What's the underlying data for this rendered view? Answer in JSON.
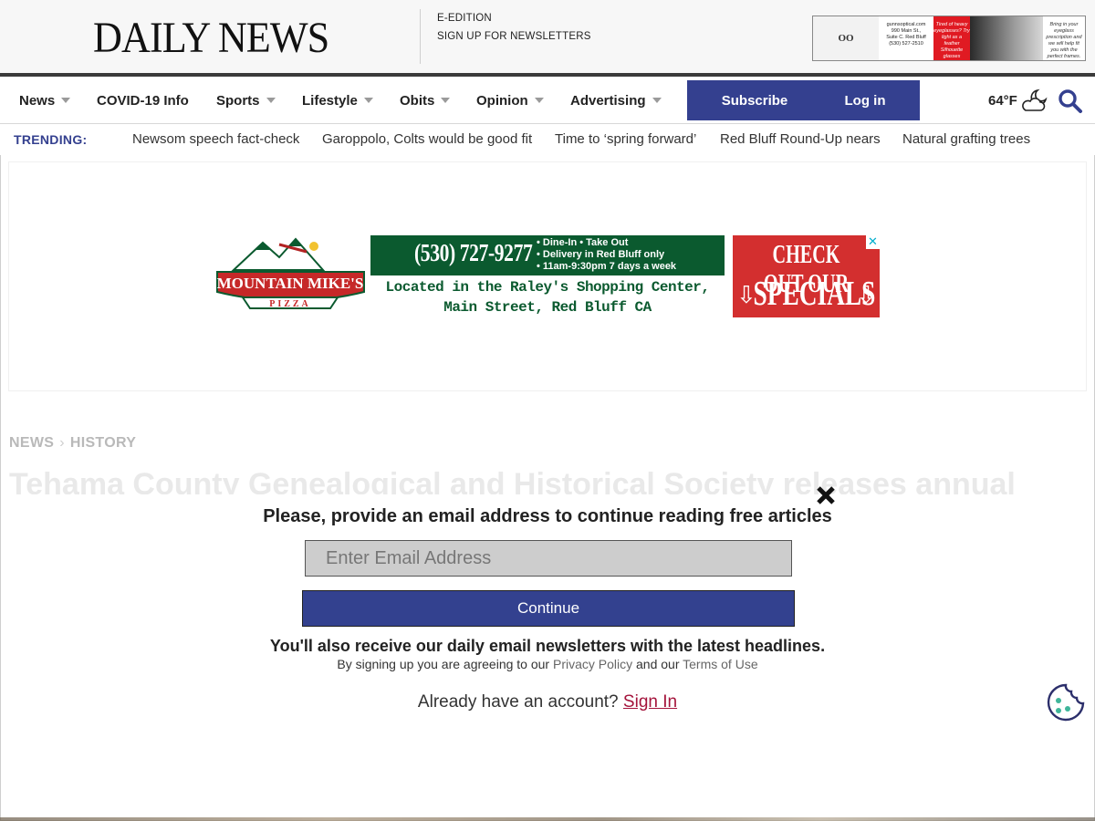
{
  "masthead": {
    "logo": "DAILY NEWS",
    "links": [
      "E-EDITION",
      "SIGN UP FOR NEWSLETTERS"
    ],
    "top_ad": {
      "brand": "OO",
      "address": [
        "gunnsoptical.com",
        "990 Main St.,",
        "Suite C. Red Bluff",
        "(530) 527-2510"
      ],
      "red_text": "Tired of heavy eyeglasses? Try light as a feather Silhouette glasses",
      "right_text": "Bring in your eyeglass prescription and we will help fit you with the perfect frames."
    }
  },
  "nav": {
    "items": [
      {
        "label": "News",
        "has_dropdown": true
      },
      {
        "label": "COVID-19 Info",
        "has_dropdown": false
      },
      {
        "label": "Sports",
        "has_dropdown": true
      },
      {
        "label": "Lifestyle",
        "has_dropdown": true
      },
      {
        "label": "Obits",
        "has_dropdown": true
      },
      {
        "label": "Opinion",
        "has_dropdown": true
      },
      {
        "label": "Advertising",
        "has_dropdown": true
      }
    ],
    "subscribe_label": "Subscribe",
    "login_label": "Log in",
    "temperature": "64°F",
    "weather_icon": "partly-cloudy-night-icon",
    "search_icon": "search-icon"
  },
  "trending": {
    "label": "TRENDING:",
    "items": [
      "Newsom speech fact-check",
      "Garoppolo, Colts would be good fit",
      "Time to ‘spring forward’",
      "Red Bluff Round-Up nears",
      "Natural grafting trees"
    ]
  },
  "banner_ad": {
    "logo_text": "MOUNTAIN MIKE'S",
    "logo_sub": "PIZZA",
    "phone": "(530) 727-9277",
    "bullets": [
      "• Dine-In • Take Out",
      "• Delivery in Red Bluff only",
      "• 11am-9:30pm  7 days a week"
    ],
    "location_lines": [
      "Located in the Raley's Shopping Center,",
      "Main Street, Red Bluff CA"
    ],
    "cta_line1": "CHECK OUT OUR",
    "cta_line2": "SPECIALS"
  },
  "article": {
    "breadcrumb": [
      "NEWS",
      "HISTORY"
    ],
    "headline": "Tehama County Genealogical and Historical Society releases annual"
  },
  "modal": {
    "title": "Please, provide an email address to continue reading free articles",
    "email_placeholder": "Enter Email Address",
    "continue_label": "Continue",
    "also_text": "You'll also receive our daily email newsletters with the latest headlines.",
    "agree_prefix": "By signing up you are agreeing to our",
    "privacy_label": "Privacy Policy",
    "agree_middle": "and our",
    "terms_label": "Terms of Use",
    "already_text": "Already have an account?",
    "signin_label": "Sign In"
  },
  "colors": {
    "brand_blue": "#34408f",
    "signin_red": "#a4133b",
    "nav_bar_dark": "#3a3a3a"
  }
}
